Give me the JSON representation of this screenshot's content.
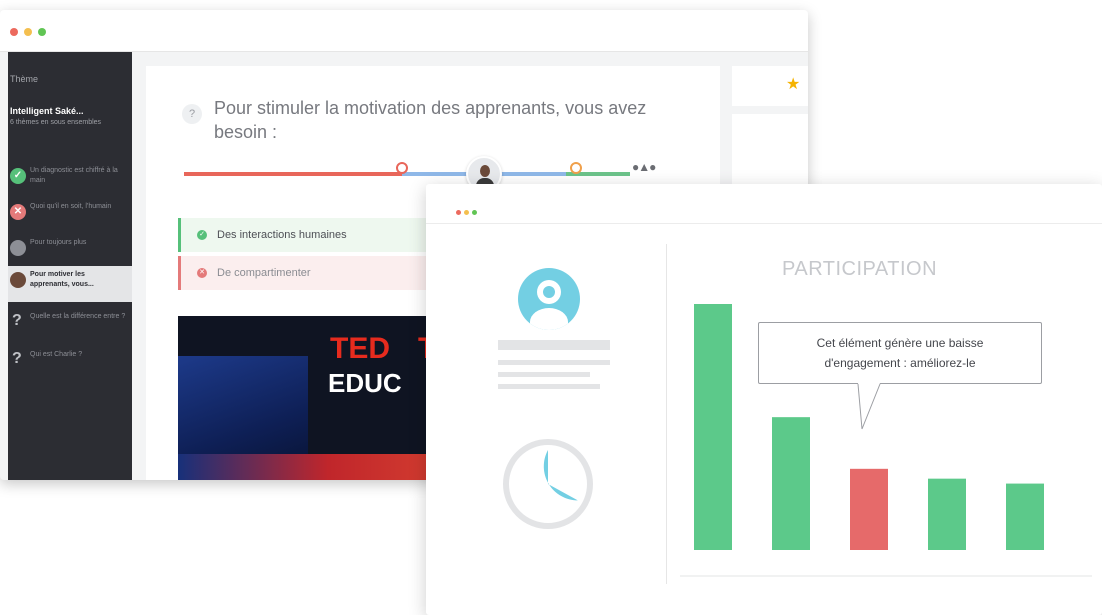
{
  "back_window": {
    "sidebar": {
      "header": "Thème",
      "course_title": "Intelligent Saké...",
      "course_subtitle": "6 thèmes en sous ensembles",
      "items": [
        {
          "label": "Un diagnostic est chiffré à la main",
          "status": "done"
        },
        {
          "label": "Quoi qu'il en soit, l'humain",
          "status": "failed"
        },
        {
          "label": "Pour toujours plus",
          "status": "pending"
        },
        {
          "label": "Pour motiver les apprenants, vous...",
          "status": "active"
        },
        {
          "label": "Quelle est la différence entre ?",
          "status": "question"
        },
        {
          "label": "Qui est Charlie ?",
          "status": "question"
        }
      ]
    },
    "question": {
      "badge": "?",
      "text": "Pour stimuler la motivation des apprenants, vous avez besoin :"
    },
    "answers": [
      {
        "label": "Des interactions humaines",
        "correct": true
      },
      {
        "label": "De compartimenter",
        "correct": false
      }
    ],
    "video": {
      "brand_line1": "TED",
      "brand_line1b": "T",
      "brand_line2": "EDUC"
    },
    "colors": {
      "progress_red": "#e8665a",
      "progress_blue": "#8fb8e8",
      "progress_green": "#6cc38a",
      "star": "#f5b301"
    }
  },
  "front_window": {
    "chart_data": {
      "type": "bar",
      "title": "PARTICIPATION",
      "categories": [
        "",
        "",
        "",
        "",
        ""
      ],
      "values": [
        100,
        54,
        33,
        29,
        27
      ],
      "colors": [
        "#5cc98a",
        "#5cc98a",
        "#e66a6a",
        "#5cc98a",
        "#5cc98a"
      ],
      "ylim": [
        0,
        100
      ],
      "highlight_index": 2
    },
    "tooltip": {
      "line1": "Cet élément génère une baisse",
      "line2": "d'engagement : améliorez-le"
    },
    "donut": {
      "fill_fraction": 0.33,
      "color": "#73cfe3"
    }
  }
}
